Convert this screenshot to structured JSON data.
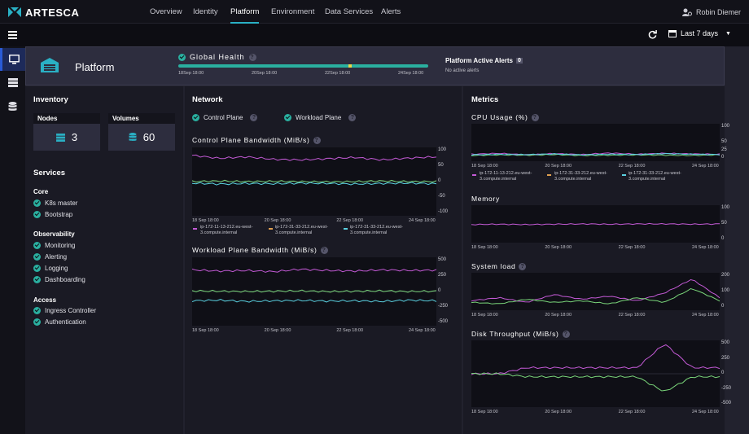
{
  "app": {
    "name": "ARTESCA"
  },
  "nav": {
    "links": [
      "Overview",
      "Identity",
      "Platform",
      "Environment",
      "Data Services",
      "Alerts"
    ],
    "active": "Platform"
  },
  "user": {
    "name": "Robin Diemer"
  },
  "toolbar": {
    "timerange": "Last 7 days"
  },
  "header": {
    "title": "Platform",
    "global_health": "Global Health",
    "health_dates": [
      "18Sep 18:00",
      "20Sep 18:00",
      "22Sep 18:00",
      "24Sep 18:00"
    ],
    "alerts_label": "Platform Active Alerts",
    "alerts_count": "0",
    "alerts_status": "No active alerts"
  },
  "inventory": {
    "title": "Inventory",
    "nodes_label": "Nodes",
    "nodes_value": "3",
    "volumes_label": "Volumes",
    "volumes_value": "60"
  },
  "services": {
    "title": "Services",
    "groups": [
      {
        "name": "Core",
        "items": [
          "K8s master",
          "Bootstrap"
        ]
      },
      {
        "name": "Observability",
        "items": [
          "Monitoring",
          "Alerting",
          "Logging",
          "Dashboarding"
        ]
      },
      {
        "name": "Access",
        "items": [
          "Ingress Controller",
          "Authentication"
        ]
      }
    ]
  },
  "network": {
    "title": "Network",
    "control_plane": "Control Plane",
    "workload_plane": "Workload Plane",
    "cp_chart_title": "Control Plane Bandwidth (MiB/s)",
    "wp_chart_title": "Workload Plane Bandwidth (MiB/s)",
    "legend": [
      "ip-172-11-13-212.eu-west-3.compute.internal",
      "ip-172-31-33-212.eu-west-3.compute.internal",
      "ip-172-31-33-212.eu-west-3.compute.internal"
    ]
  },
  "metrics": {
    "title": "Metrics",
    "cpu_title": "CPU Usage (%)",
    "memory_title": "Memory",
    "load_title": "System load",
    "disk_title": "Disk Throughput (MiB/s)"
  },
  "colors": {
    "accent": "#2ab0c4",
    "series": [
      "#c45ad6",
      "#e0a050",
      "#5ad0e0",
      "#7ad67a"
    ]
  },
  "chart_data": [
    {
      "type": "line",
      "title": "Control Plane Bandwidth (MiB/s)",
      "x": [
        "18 Sep 18:00",
        "20 Sep 18:00",
        "22 Sep 18:00",
        "24 Sep 18:00"
      ],
      "yticks": [
        100,
        50,
        0,
        -50,
        -100
      ],
      "ylim": [
        -100,
        100
      ],
      "series": [
        {
          "name": "ip-172-11-13-212.eu-west-3.compute.internal",
          "values": [
            85,
            75,
            80,
            72,
            70,
            74,
            78,
            70,
            76,
            80
          ]
        },
        {
          "name": "ip-172-31-33-212.eu-west-3.compute.internal",
          "values": [
            0,
            2,
            0,
            1,
            0,
            -1,
            0,
            2,
            0,
            0
          ]
        },
        {
          "name": "ip-172-31-33-212.eu-west-3.compute.internal",
          "values": [
            -5,
            -8,
            -6,
            -7,
            -5,
            -6,
            -8,
            -6,
            -5,
            -7
          ]
        }
      ]
    },
    {
      "type": "line",
      "title": "Workload Plane Bandwidth (MiB/s)",
      "x": [
        "18 Sep 18:00",
        "20 Sep 18:00",
        "22 Sep 18:00",
        "24 Sep 18:00"
      ],
      "yticks": [
        500,
        250,
        0,
        -250,
        -500
      ],
      "ylim": [
        -500,
        500
      ],
      "series": [
        {
          "name": "ip-172-11-13-212.eu-west-3.compute.internal",
          "values": [
            350,
            330,
            340,
            320,
            360,
            340,
            330,
            350,
            340,
            345
          ]
        },
        {
          "name": "ip-172-31-33-212.eu-west-3.compute.internal",
          "values": [
            10,
            5,
            0,
            5,
            10,
            0,
            5,
            10,
            0,
            5
          ]
        },
        {
          "name": "ip-172-31-33-212.eu-west-3.compute.internal",
          "values": [
            -150,
            -140,
            -160,
            -150,
            -145,
            -155,
            -150,
            -160,
            -140,
            -150
          ]
        }
      ]
    },
    {
      "type": "line",
      "title": "CPU Usage (%)",
      "x": [
        "18 Sep 18:00",
        "20 Sep 18:00",
        "22 Sep 18:00",
        "24 Sep 18:00"
      ],
      "yticks": [
        100,
        50,
        25,
        0
      ],
      "ylim": [
        0,
        100
      ],
      "series": [
        {
          "name": "ip-172-11-13-212.eu-west-3.compute.internal",
          "values": [
            12,
            15,
            10,
            14,
            11,
            16,
            12,
            15,
            13,
            12
          ]
        },
        {
          "name": "ip-172-31-33-212.eu-west-3.compute.internal",
          "values": [
            8,
            10,
            9,
            11,
            8,
            9,
            10,
            9,
            8,
            10
          ]
        },
        {
          "name": "ip-172-31-33-212.eu-west-3.compute.internal",
          "values": [
            10,
            12,
            11,
            13,
            10,
            12,
            11,
            14,
            12,
            11
          ]
        }
      ]
    },
    {
      "type": "line",
      "title": "Memory",
      "x": [
        "18 Sep 18:00",
        "20 Sep 18:00",
        "22 Sep 18:00",
        "24 Sep 18:00"
      ],
      "yticks": [
        100,
        50,
        0
      ],
      "ylim": [
        0,
        100
      ],
      "series": [
        {
          "name": "ip-172-11-13-212.eu-west-3.compute.internal",
          "values": [
            48,
            49,
            48,
            49,
            50,
            49,
            50,
            50,
            49,
            50
          ]
        }
      ]
    },
    {
      "type": "line",
      "title": "System load",
      "x": [
        "18 Sep 18:00",
        "20 Sep 18:00",
        "22 Sep 18:00",
        "24 Sep 18:00"
      ],
      "yticks": [
        200,
        100,
        0
      ],
      "ylim": [
        0,
        200
      ],
      "series": [
        {
          "name": "ip-172-11-13-212.eu-west-3.compute.internal",
          "values": [
            40,
            60,
            30,
            80,
            50,
            70,
            40,
            90,
            180,
            60
          ]
        },
        {
          "name": "ip-172-31-33-212.eu-west-3.compute.internal",
          "values": [
            30,
            20,
            50,
            30,
            40,
            20,
            60,
            30,
            120,
            40
          ]
        }
      ]
    },
    {
      "type": "line",
      "title": "Disk Throughput (MiB/s)",
      "x": [
        "18 Sep 18:00",
        "20 Sep 18:00",
        "22 Sep 18:00",
        "24 Sep 18:00"
      ],
      "yticks": [
        500,
        250,
        0,
        -250,
        -500
      ],
      "ylim": [
        -500,
        500
      ],
      "series": [
        {
          "name": "ip-172-11-13-212.eu-west-3.compute.internal",
          "values": [
            0,
            0,
            100,
            100,
            100,
            100,
            100,
            500,
            100,
            100
          ]
        },
        {
          "name": "ip-172-31-33-212.eu-west-3.compute.internal",
          "values": [
            0,
            0,
            -50,
            -50,
            -50,
            -50,
            -50,
            -300,
            -50,
            -50
          ]
        }
      ]
    }
  ]
}
